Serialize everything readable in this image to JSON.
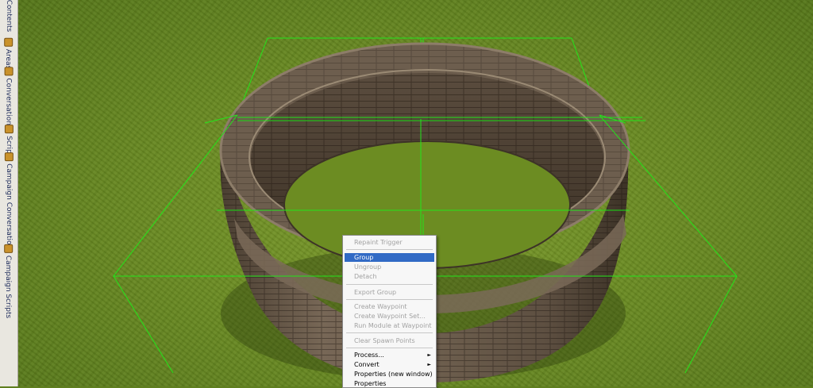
{
  "tabstrip": {
    "tabs": [
      {
        "label": "Contents"
      },
      {
        "label": "Areas"
      },
      {
        "label": "Conversations"
      },
      {
        "label": "Scripts"
      },
      {
        "label": "Campaign Conversations"
      },
      {
        "label": "Campaign Scripts"
      }
    ]
  },
  "context_menu": {
    "items": {
      "repaint_trigger": "Repaint Trigger",
      "group": "Group",
      "ungroup": "Ungroup",
      "detach": "Detach",
      "export_group": "Export Group",
      "create_waypoint": "Create Waypoint",
      "create_waypoint_set": "Create Waypoint Set...",
      "run_module_at_waypoint": "Run Module at Waypoint",
      "clear_spawn_points": "Clear Spawn Points",
      "process": "Process...",
      "convert": "Convert",
      "properties_new_window": "Properties (new window)",
      "properties": "Properties"
    },
    "submenu_arrow": "►",
    "selected_item": "Group"
  },
  "colors": {
    "selection_box": "#22e61a",
    "menu_highlight": "#316ac5",
    "grass": "#6a8b22"
  }
}
